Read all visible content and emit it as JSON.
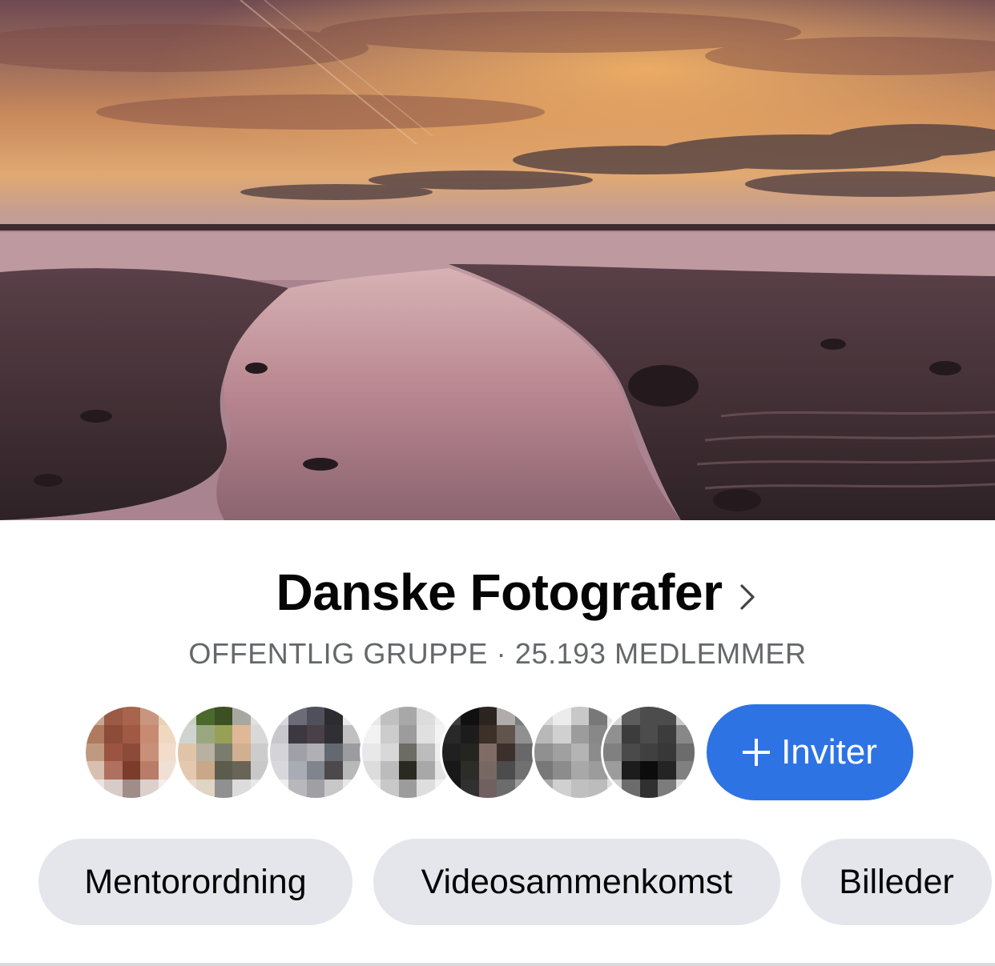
{
  "group": {
    "name": "Danske Fotografer",
    "meta": "OFFENTLIG GRUPPE · 25.193 MEDLEMMER"
  },
  "actions": {
    "invite_label": "Inviter"
  },
  "tags": [
    "Mentorordning",
    "Videosammenkomst",
    "Billeder"
  ],
  "icons": {
    "title": "chevron-right-icon",
    "invite": "plus-icon"
  },
  "colors": {
    "accent": "#2e73e4",
    "chip_bg": "#e4e6eb",
    "meta_text": "#65676b"
  }
}
